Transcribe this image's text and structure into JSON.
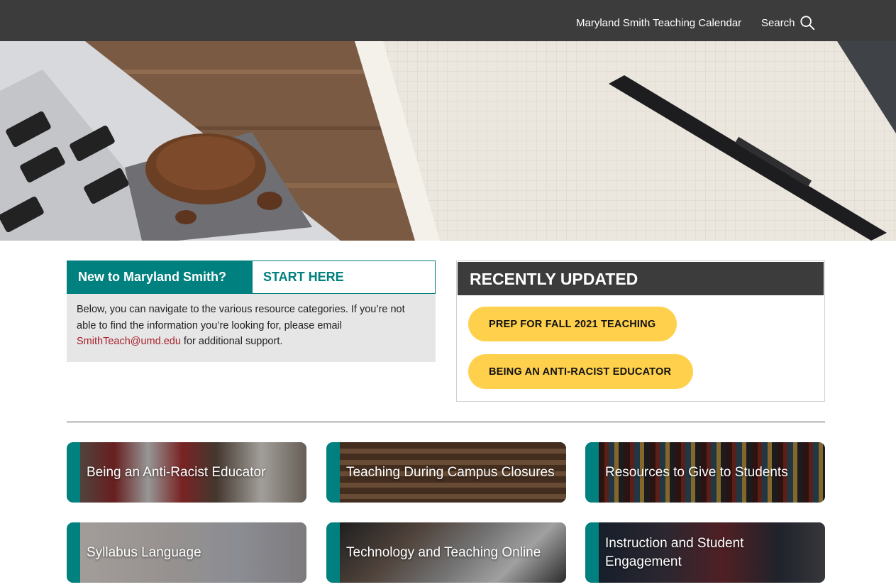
{
  "header": {
    "calendar_link": "Maryland Smith Teaching Calendar",
    "search_label": "Search"
  },
  "intro": {
    "title": "New to Maryland Smith?",
    "start_here": "START HERE",
    "body_before": "Below, you can navigate to the various resource categories. If you’re not able to find the information you’re looking for, please email ",
    "email": "SmithTeach@umd.edu",
    "body_after": " for additional support."
  },
  "recent": {
    "heading": "RECENTLY UPDATED",
    "items": [
      "PREP FOR FALL 2021 TEACHING",
      "BEING AN ANTI-RACIST EDUCATOR"
    ]
  },
  "cards": [
    "Being an Anti-Racist Educator",
    "Teaching During Campus Closures",
    "Resources to Give to Students",
    "Syllabus Language",
    "Technology and Teaching Online",
    "Instruction and Student Engagement"
  ],
  "colors": {
    "teal": "#00807e",
    "dark_bar": "#3c3c3c",
    "pill_yellow": "#ffd04b",
    "email_red": "#a8202c"
  }
}
